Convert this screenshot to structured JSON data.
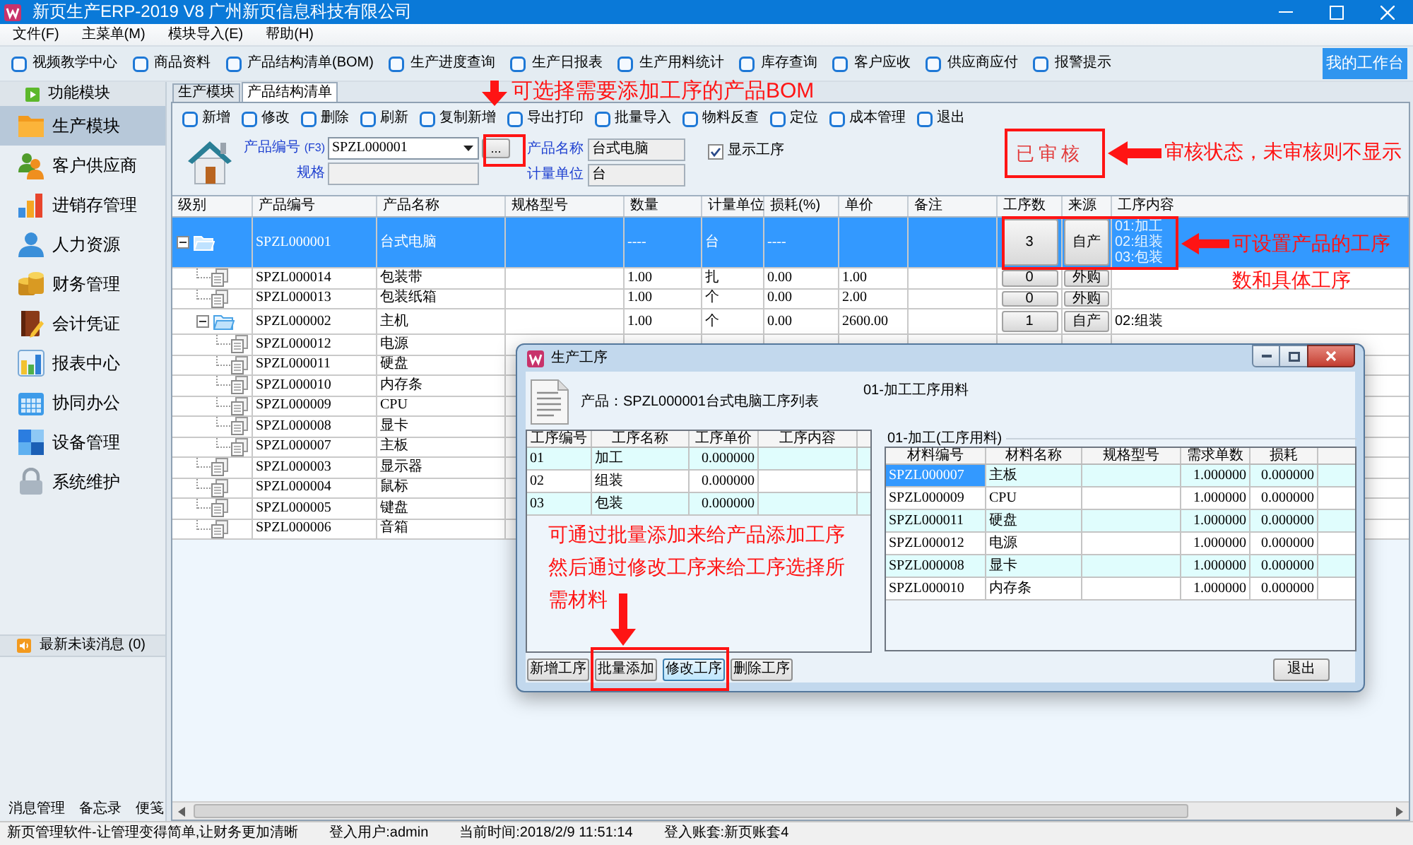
{
  "window": {
    "title": "新页生产ERP-2019 V8 广州新页信息科技有限公司"
  },
  "menu": [
    "文件(F)",
    "主菜单(M)",
    "模块导入(E)",
    "帮助(H)"
  ],
  "quick_toolbar": {
    "items": [
      "视频教学中心",
      "商品资料",
      "产品结构清单(BOM)",
      "生产进度查询",
      "生产日报表",
      "生产用料统计",
      "库存查询",
      "客户应收",
      "供应商应付",
      "报警提示"
    ],
    "workbench_button": "我的工作台"
  },
  "sidebar": {
    "header": "功能模块",
    "items": [
      {
        "label": "生产模块",
        "selected": true
      },
      {
        "label": "客户供应商",
        "selected": false
      },
      {
        "label": "进销存管理",
        "selected": false
      },
      {
        "label": "人力资源",
        "selected": false
      },
      {
        "label": "财务管理",
        "selected": false
      },
      {
        "label": "会计凭证",
        "selected": false
      },
      {
        "label": "报表中心",
        "selected": false
      },
      {
        "label": "协同办公",
        "selected": false
      },
      {
        "label": "设备管理",
        "selected": false
      },
      {
        "label": "系统维护",
        "selected": false
      }
    ],
    "messages": "最新未读消息 (0)",
    "footer_links": [
      "消息管理",
      "备忘录",
      "便笺"
    ]
  },
  "tabs": [
    {
      "label": "生产模块",
      "selected": false
    },
    {
      "label": "产品结构清单",
      "selected": true
    }
  ],
  "toolbar": [
    "新增",
    "修改",
    "删除",
    "刷新",
    "复制新增",
    "导出打印",
    "批量导入",
    "物料反查",
    "定位",
    "成本管理",
    "退出"
  ],
  "form": {
    "code_label": "产品编号",
    "code_hint": "(F3)",
    "code": "SPZL000001",
    "browse_button": "...",
    "spec_label": "规格",
    "name_label": "产品名称",
    "name": "台式电脑",
    "unit_label": "计量单位",
    "unit": "台",
    "show_process": {
      "label": "显示工序",
      "checked": true
    },
    "audit_stamp": "已审核"
  },
  "table": {
    "columns": [
      "级别",
      "产品编号",
      "产品名称",
      "规格型号",
      "数量",
      "计量单位",
      "损耗(%)",
      "单价",
      "备注",
      "工序数",
      "来源",
      "工序内容"
    ],
    "rows": [
      {
        "code": "SPZL000001",
        "name": "台式电脑",
        "qty": "----",
        "unit": "台",
        "loss": "----",
        "process_count": "3",
        "source": "自产",
        "process_content": [
          "01:加工",
          "02:组装",
          "03:包装"
        ],
        "selected": true,
        "expanded": true,
        "children": [
          {
            "code": "SPZL000014",
            "name": "包装带",
            "qty": "1.00",
            "unit": "扎",
            "loss": "0.00",
            "price": "1.00",
            "process_count": "0",
            "source": "外购",
            "selected": false
          },
          {
            "code": "SPZL000013",
            "name": "包装纸箱",
            "qty": "1.00",
            "unit": "个",
            "loss": "0.00",
            "price": "2.00",
            "process_count": "0",
            "source": "外购",
            "selected": false
          },
          {
            "code": "SPZL000002",
            "name": "主机",
            "qty": "1.00",
            "unit": "个",
            "loss": "0.00",
            "price": "2600.00",
            "process_count": "1",
            "source": "自产",
            "process_content": [
              "02:组装"
            ],
            "selected": false,
            "expanded": true,
            "children": [
              {
                "code": "SPZL000012",
                "name": "电源",
                "selected": false
              },
              {
                "code": "SPZL000011",
                "name": "硬盘",
                "selected": false
              },
              {
                "code": "SPZL000010",
                "name": "内存条",
                "selected": false
              },
              {
                "code": "SPZL000009",
                "name": "CPU",
                "selected": false
              },
              {
                "code": "SPZL000008",
                "name": "显卡",
                "selected": false
              },
              {
                "code": "SPZL000007",
                "name": "主板",
                "selected": false
              }
            ]
          },
          {
            "code": "SPZL000003",
            "name": "显示器",
            "selected": false
          },
          {
            "code": "SPZL000004",
            "name": "鼠标",
            "selected": false
          },
          {
            "code": "SPZL000005",
            "name": "键盘",
            "selected": false
          },
          {
            "code": "SPZL000006",
            "name": "音箱",
            "selected": false
          }
        ]
      }
    ]
  },
  "dialog": {
    "title": "生产工序",
    "product_caption": "产品：SPZL000001台式电脑工序列表",
    "materials_caption": "01-加工工序用料",
    "process_table": {
      "columns": [
        "工序编号",
        "工序名称",
        "工序单价",
        "工序内容"
      ],
      "rows": [
        {
          "no": "01",
          "name": "加工",
          "price": "0.000000"
        },
        {
          "no": "02",
          "name": "组装",
          "price": "0.000000"
        },
        {
          "no": "03",
          "name": "包装",
          "price": "0.000000"
        }
      ]
    },
    "materials_group": "01-加工(工序用料)",
    "materials_table": {
      "columns": [
        "材料编号",
        "材料名称",
        "规格型号",
        "需求单数",
        "损耗"
      ],
      "rows": [
        {
          "code": "SPZL000007",
          "name": "主板",
          "qty": "1.000000",
          "loss": "0.000000",
          "selected": true
        },
        {
          "code": "SPZL000009",
          "name": "CPU",
          "qty": "1.000000",
          "loss": "0.000000",
          "selected": false
        },
        {
          "code": "SPZL000011",
          "name": "硬盘",
          "qty": "1.000000",
          "loss": "0.000000",
          "selected": false
        },
        {
          "code": "SPZL000012",
          "name": "电源",
          "qty": "1.000000",
          "loss": "0.000000",
          "selected": false
        },
        {
          "code": "SPZL000008",
          "name": "显卡",
          "qty": "1.000000",
          "loss": "0.000000",
          "selected": false
        },
        {
          "code": "SPZL000010",
          "name": "内存条",
          "qty": "1.000000",
          "loss": "0.000000",
          "selected": false
        }
      ]
    },
    "buttons": [
      {
        "label": "新增工序",
        "focused": false
      },
      {
        "label": "批量添加",
        "focused": false
      },
      {
        "label": "修改工序",
        "focused": true
      },
      {
        "label": "删除工序",
        "focused": false
      }
    ],
    "exit_button": "退出"
  },
  "annotations": {
    "browse_note": "可选择需要添加工序的产品BOM",
    "audit_note": "审核状态，未审核则不显示",
    "process_note": "可设置产品的工序数和具体工序",
    "dialog_note": "可通过批量添加来给产品添加工序然后通过修改工序来给工序选择所需材料"
  },
  "status_bar": [
    "新页管理软件-让管理变得简单,让财务更加清晰",
    "登入用户:admin",
    "当前时间:2018/2/9 11:51:14",
    "登入账套:新页账套4"
  ]
}
